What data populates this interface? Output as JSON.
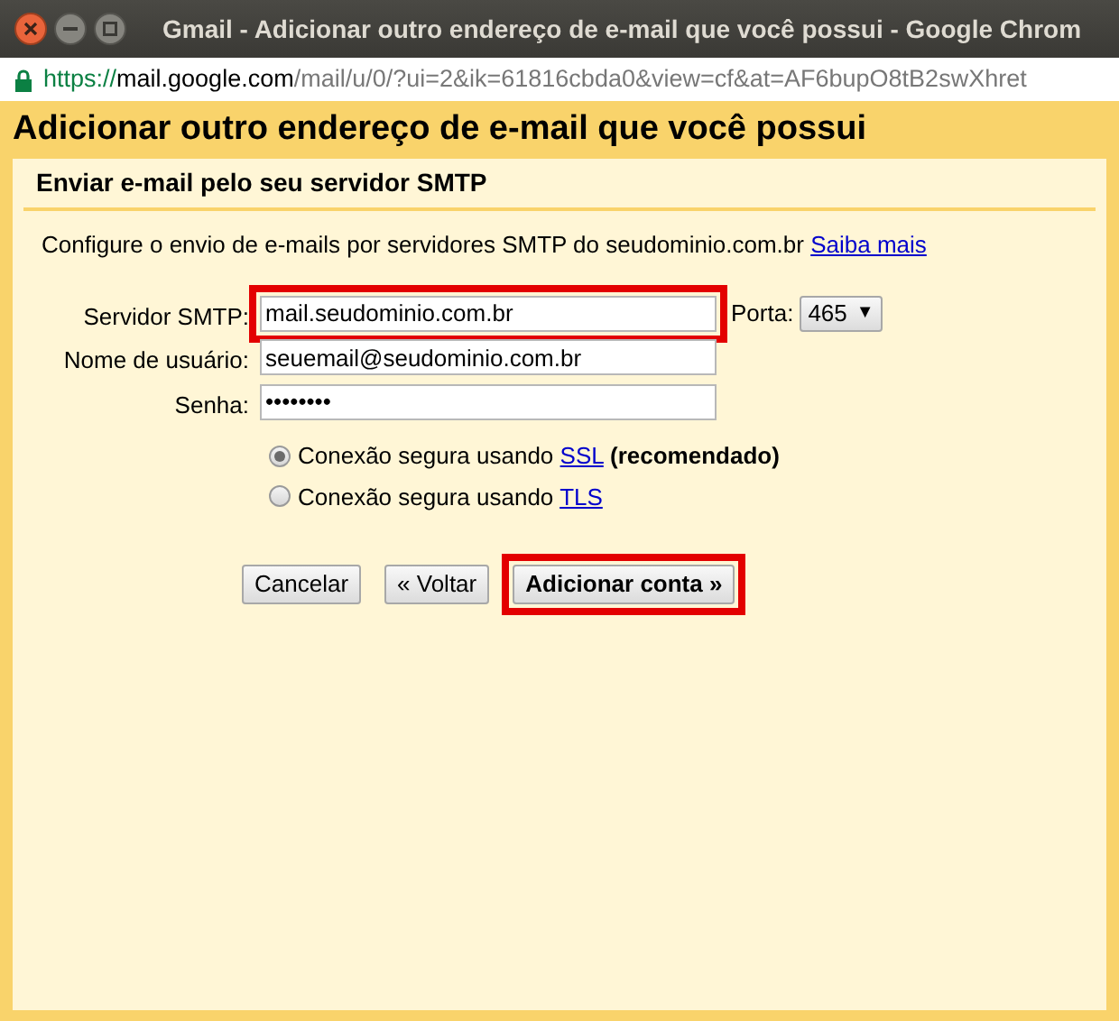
{
  "window": {
    "title": "Gmail - Adicionar outro endereço de e-mail que você possui - Google Chrom"
  },
  "address_bar": {
    "scheme": "https://",
    "host": "mail.google.com",
    "path": "/mail/u/0/?ui=2&ik=61816cbda0&view=cf&at=AF6bupO8tB2swXhret"
  },
  "page_title": "Adicionar outro endereço de e-mail que você possui",
  "section_title": "Enviar e-mail pelo seu servidor SMTP",
  "intro": {
    "text": "Configure o envio de e-mails por servidores SMTP do seudominio.com.br",
    "link": "Saiba mais"
  },
  "fields": [
    {
      "label": "Servidor SMTP:",
      "value": "mail.seudominio.com.br",
      "highlighted": true
    },
    {
      "label": "Nome de usuário:",
      "value": "seuemail@seudominio.com.br",
      "highlighted": false
    },
    {
      "label": "Senha:",
      "value": "••••••••",
      "highlighted": false
    }
  ],
  "port": {
    "label": "Porta:",
    "value": "465",
    "arrow": "▼"
  },
  "security_options": [
    {
      "text": "Conexão segura usando",
      "link": "SSL",
      "note": "(recomendado)",
      "selected": true
    },
    {
      "text": "Conexão segura usando",
      "link": "TLS",
      "selected": false
    }
  ],
  "buttons": [
    {
      "label": "Cancelar",
      "primary": false,
      "highlighted": false
    },
    {
      "label": "« Voltar",
      "primary": false,
      "highlighted": false
    },
    {
      "label": "Adicionar conta »",
      "primary": true,
      "highlighted": true
    }
  ]
}
